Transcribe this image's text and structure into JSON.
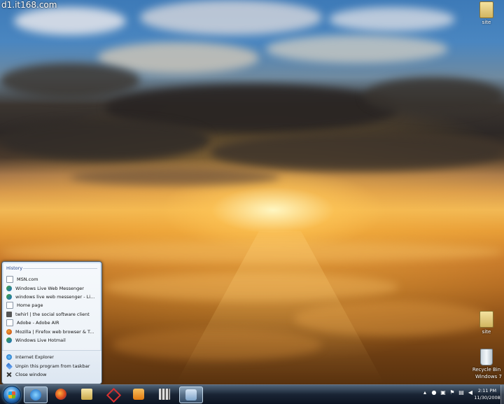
{
  "watermark": "d1.it168.com",
  "desktop_icons": {
    "site_top": "site",
    "site_bottom": "site",
    "recycle_bin": "Recycle Bin",
    "os_label": "Windows 7"
  },
  "jumplist": {
    "header": "History",
    "history": [
      {
        "label": "MSN.com",
        "icon": "page-icon"
      },
      {
        "label": "Windows Live Web Messenger",
        "icon": "msn-icon"
      },
      {
        "label": "windows live web messenger - Li...",
        "icon": "msn-icon"
      },
      {
        "label": "Home page",
        "icon": "page-icon"
      },
      {
        "label": "twhirl | the social software client",
        "icon": "twhirl-icon"
      },
      {
        "label": "Adobe - Adobe AIR",
        "icon": "page-icon"
      },
      {
        "label": "Mozilla | Firefox web browser & T...",
        "icon": "firefox-icon"
      },
      {
        "label": "Windows Live Hotmail",
        "icon": "msn-icon"
      }
    ],
    "tasks": [
      {
        "label": "Internet Explorer",
        "icon": "ie-icon"
      },
      {
        "label": "Unpin this program from taskbar",
        "icon": "pin-icon"
      },
      {
        "label": "Close window",
        "icon": "close-icon"
      }
    ]
  },
  "taskbar": {
    "buttons": [
      {
        "name": "internet-explorer",
        "icon": "ie-icon",
        "active": true
      },
      {
        "name": "firefox",
        "icon": "firefox-icon",
        "active": false
      },
      {
        "name": "explorer-folder",
        "icon": "folder-icon",
        "active": false
      },
      {
        "name": "program",
        "icon": "star-icon",
        "active": false
      },
      {
        "name": "media-player",
        "icon": "media-icon",
        "active": false
      },
      {
        "name": "film-app",
        "icon": "film-icon",
        "active": false
      },
      {
        "name": "camera-app",
        "icon": "camera-icon",
        "active": true
      }
    ],
    "clock_time": "2:11 PM",
    "clock_date": "11/30/2008"
  }
}
